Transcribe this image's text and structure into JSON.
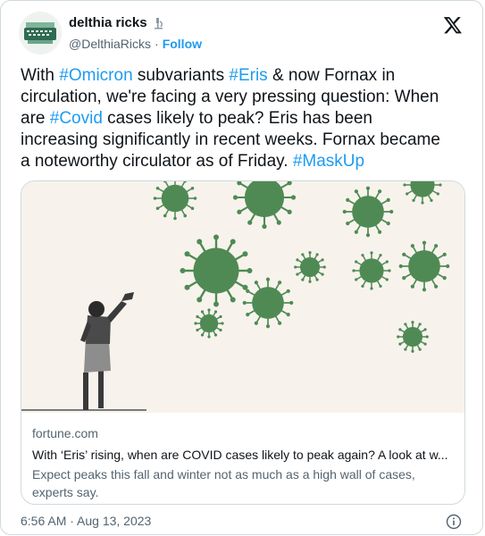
{
  "author": {
    "name": "delthia ricks",
    "handle": "@DelthiaRicks",
    "separator": "·",
    "follow_label": "Follow"
  },
  "tweet": {
    "segments": [
      {
        "text": "With ",
        "tag": false
      },
      {
        "text": "#Omicron",
        "tag": true
      },
      {
        "text": " subvariants ",
        "tag": false
      },
      {
        "text": "#Eris",
        "tag": true
      },
      {
        "text": " & now Fornax in circulation, we're facing a very pressing question: When are ",
        "tag": false
      },
      {
        "text": "#Covid",
        "tag": true
      },
      {
        "text": " cases likely to peak? Eris has been increasing significantly in recent weeks. Fornax became a noteworthy circulator as of Friday. ",
        "tag": false
      },
      {
        "text": "#MaskUp",
        "tag": true
      }
    ]
  },
  "link_card": {
    "domain": "fortune.com",
    "headline": "With ‘Eris’ rising, when are COVID cases likely to peak again? A look at w...",
    "description": "Expect peaks this fall and winter not as much as a high wall of cases, experts say."
  },
  "footer": {
    "timestamp": "6:56 AM · Aug 13, 2023"
  },
  "colors": {
    "accent": "#1d9bf0",
    "virus": "#4f8a54",
    "image_bg": "#f7f3ec"
  }
}
